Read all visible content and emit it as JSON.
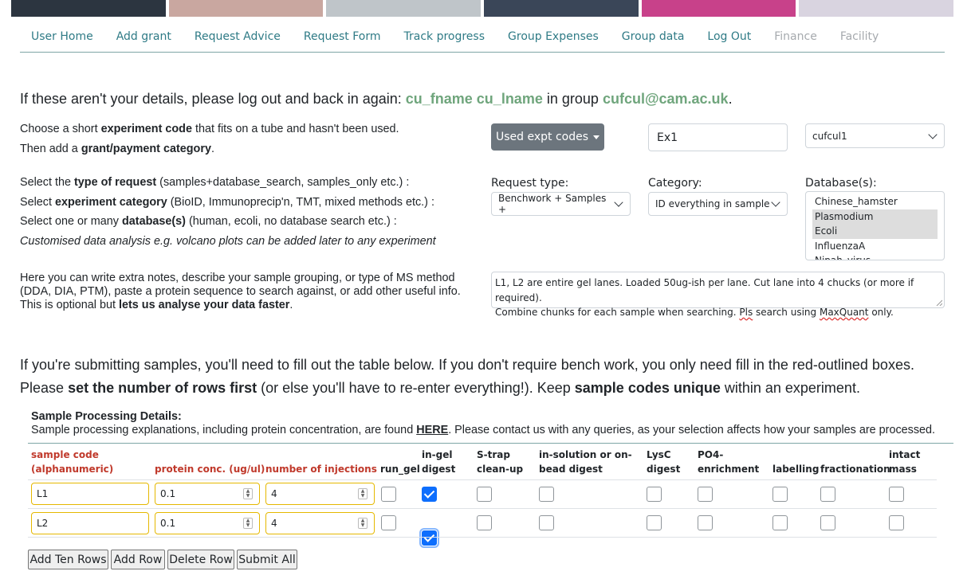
{
  "banner": {
    "colors": [
      "#2c3540",
      "#c9a7a0",
      "#bfc5c9",
      "#3a4658",
      "#c8418a",
      "#d9d4e0"
    ]
  },
  "nav": [
    {
      "label": "User Home",
      "enabled": true
    },
    {
      "label": "Add grant",
      "enabled": true
    },
    {
      "label": "Request Advice",
      "enabled": true
    },
    {
      "label": "Request Form",
      "enabled": true
    },
    {
      "label": "Track progress",
      "enabled": true
    },
    {
      "label": "Group Expenses",
      "enabled": true
    },
    {
      "label": "Group data",
      "enabled": true
    },
    {
      "label": "Log Out",
      "enabled": true
    },
    {
      "label": "Finance",
      "enabled": false
    },
    {
      "label": "Facility",
      "enabled": false
    }
  ],
  "intro": {
    "prefix": "If these aren't your details, please log out and back in again:",
    "name": "cu_fname cu_lname",
    "middle": "in group",
    "group": "cufcul@cam.ac.uk",
    "suffix": "."
  },
  "expt": {
    "line1_a": "Choose a short",
    "line1_b": "experiment code",
    "line1_c": "that fits on a tube and hasn't been used.",
    "line2_a": "Then add a",
    "line2_b": "grant/payment category",
    "line2_c": ".",
    "used_codes_button": "Used expt codes",
    "code_value": "Ex1",
    "grant_value": "cufcul1"
  },
  "request": {
    "l1_a": "Select the",
    "l1_b": "type of request",
    "l1_c": "(samples+database_search, samples_only etc.) :",
    "l2_a": "Select",
    "l2_b": "experiment category",
    "l2_c": "(BioID, Immunoprecip'n, TMT, mixed methods etc.) :",
    "l3_a": "Select one or many",
    "l3_b": "database(s)",
    "l3_c": "(human, ecoli, no database search etc.) :",
    "l4": "Customised data analysis e.g. volcano plots can be added later to any experiment",
    "type_label": "Request type:",
    "type_value": "Benchwork + Samples +",
    "category_label": "Category:",
    "category_value": "ID everything in sample",
    "db_label": "Database(s):",
    "databases": [
      "Chinese_hamster",
      "Plasmodium",
      "Ecoli",
      "InfluenzaA",
      "Nipah_virus"
    ],
    "databases_selected": [
      false,
      true,
      true,
      false,
      false
    ]
  },
  "notes": {
    "p1": "Here you can write extra notes, describe your sample grouping, or type of MS method (DDA, DIA, PTM), paste a protein sequence to search against, or add other useful info.",
    "p2_a": "This is optional but",
    "p2_b": "lets us analyse your data faster",
    "p2_c": ".",
    "text_line1": "L1, L2 are entire gel lanes. Loaded 50ug-ish per lane. Cut lane into 4 chucks (or more if required).",
    "text_line2_a": "Combine chunks for each sample when searching.",
    "text_line2_b": "Pls",
    "text_line2_c": "search using",
    "text_line2_d": "MaxQuant",
    "text_line2_e": "only."
  },
  "samples_intro": {
    "l1": "If you're submitting samples, you'll need to fill out the table below. If you don't require bench work, you only need fill in the red-outlined boxes.",
    "l2_a": "Please",
    "l2_b": "set the number of rows first",
    "l2_c": "(or else you'll have to re-enter everything!). Keep",
    "l2_d": "sample codes unique",
    "l2_e": "within an experiment."
  },
  "processing": {
    "title": "Sample Processing Details:",
    "line_a": "Sample processing explanations, including protein concentration, are found",
    "link": "HERE",
    "line_b": ". Please contact us with any queries, as your selection affects how your samples are processed."
  },
  "table": {
    "headers": {
      "code_1": "sample code",
      "code_2": "(alphanumeric)",
      "conc": "protein conc. (ug/ul)",
      "inj": "number of injections",
      "run_gel": "run_gel",
      "ingel_1": "in-gel",
      "ingel_2": "digest",
      "strap_1": "S-trap",
      "strap_2": "clean-up",
      "insol_1": "in-solution or on-",
      "insol_2": "bead digest",
      "lysc_1": "LysC",
      "lysc_2": "digest",
      "po4_1": "PO4-",
      "po4_2": "enrichment",
      "labelling": "labelling",
      "fract": "fractionation",
      "intact_1": "intact",
      "intact_2": "mass"
    },
    "rows": [
      {
        "code": "L1",
        "conc": "0.1",
        "inj": "4",
        "checks": [
          false,
          true,
          false,
          false,
          false,
          false,
          false,
          false,
          false
        ]
      },
      {
        "code": "L2",
        "conc": "0.1",
        "inj": "4",
        "checks": [
          false,
          true,
          false,
          false,
          false,
          false,
          false,
          false,
          false
        ]
      }
    ]
  },
  "buttons": {
    "add_ten": "Add Ten Rows",
    "add_row": "Add Row",
    "delete_row": "Delete Row",
    "submit_all": "Submit All"
  }
}
